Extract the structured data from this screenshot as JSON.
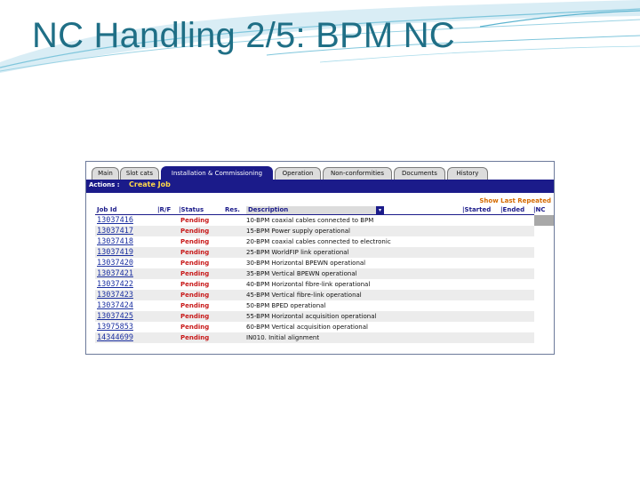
{
  "slide": {
    "title": "NC Handling 2/5: BPM NC"
  },
  "colors": {
    "title": "#1f6f86",
    "accent": "#1b1b8a",
    "status_pending": "#c81a1a",
    "link": "#1a2fa0",
    "show_last": "#d46a00"
  },
  "tabs": [
    {
      "label": "Main",
      "active": false
    },
    {
      "label": "Slot cats",
      "active": false
    },
    {
      "label": "Installation & Commissioning",
      "active": true
    },
    {
      "label": "Operation",
      "active": false
    },
    {
      "label": "Non-conformities",
      "active": false
    },
    {
      "label": "Documents",
      "active": false
    },
    {
      "label": "History",
      "active": false
    }
  ],
  "actions": {
    "label": "Actions :",
    "create_job": "Create Job"
  },
  "show_last_repeated": "Show Last Repeated",
  "columns": {
    "job_id": "Job Id",
    "rf": "|R/F",
    "status": "|Status",
    "res": "Res.",
    "description": "Description",
    "started": "|Started",
    "ended": "|Ended",
    "nc": "|NC"
  },
  "rows": [
    {
      "job_id": "13037416",
      "status": "Pending",
      "description": "10-BPM coaxial cables connected to BPM"
    },
    {
      "job_id": "13037417",
      "status": "Pending",
      "description": "15-BPM Power supply operational"
    },
    {
      "job_id": "13037418",
      "status": "Pending",
      "description": "20-BPM coaxial cables connected to electronic"
    },
    {
      "job_id": "13037419",
      "status": "Pending",
      "description": "25-BPM WorldFIP link operational"
    },
    {
      "job_id": "13037420",
      "status": "Pending",
      "description": "30-BPM Horizontal BPEWN operational"
    },
    {
      "job_id": "13037421",
      "status": "Pending",
      "description": "35-BPM Vertical BPEWN operational"
    },
    {
      "job_id": "13037422",
      "status": "Pending",
      "description": "40-BPM Horizontal fibre-link operational"
    },
    {
      "job_id": "13037423",
      "status": "Pending",
      "description": "45-BPM Vertical fibre-link operational"
    },
    {
      "job_id": "13037424",
      "status": "Pending",
      "description": "50-BPM BPED operational"
    },
    {
      "job_id": "13037425",
      "status": "Pending",
      "description": "55-BPM Horizontal acquisition operational"
    },
    {
      "job_id": "13975853",
      "status": "Pending",
      "description": "60-BPM Vertical acquisition operational"
    },
    {
      "job_id": "14344699",
      "status": "Pending",
      "description": "IN010. Initial alignment"
    }
  ]
}
